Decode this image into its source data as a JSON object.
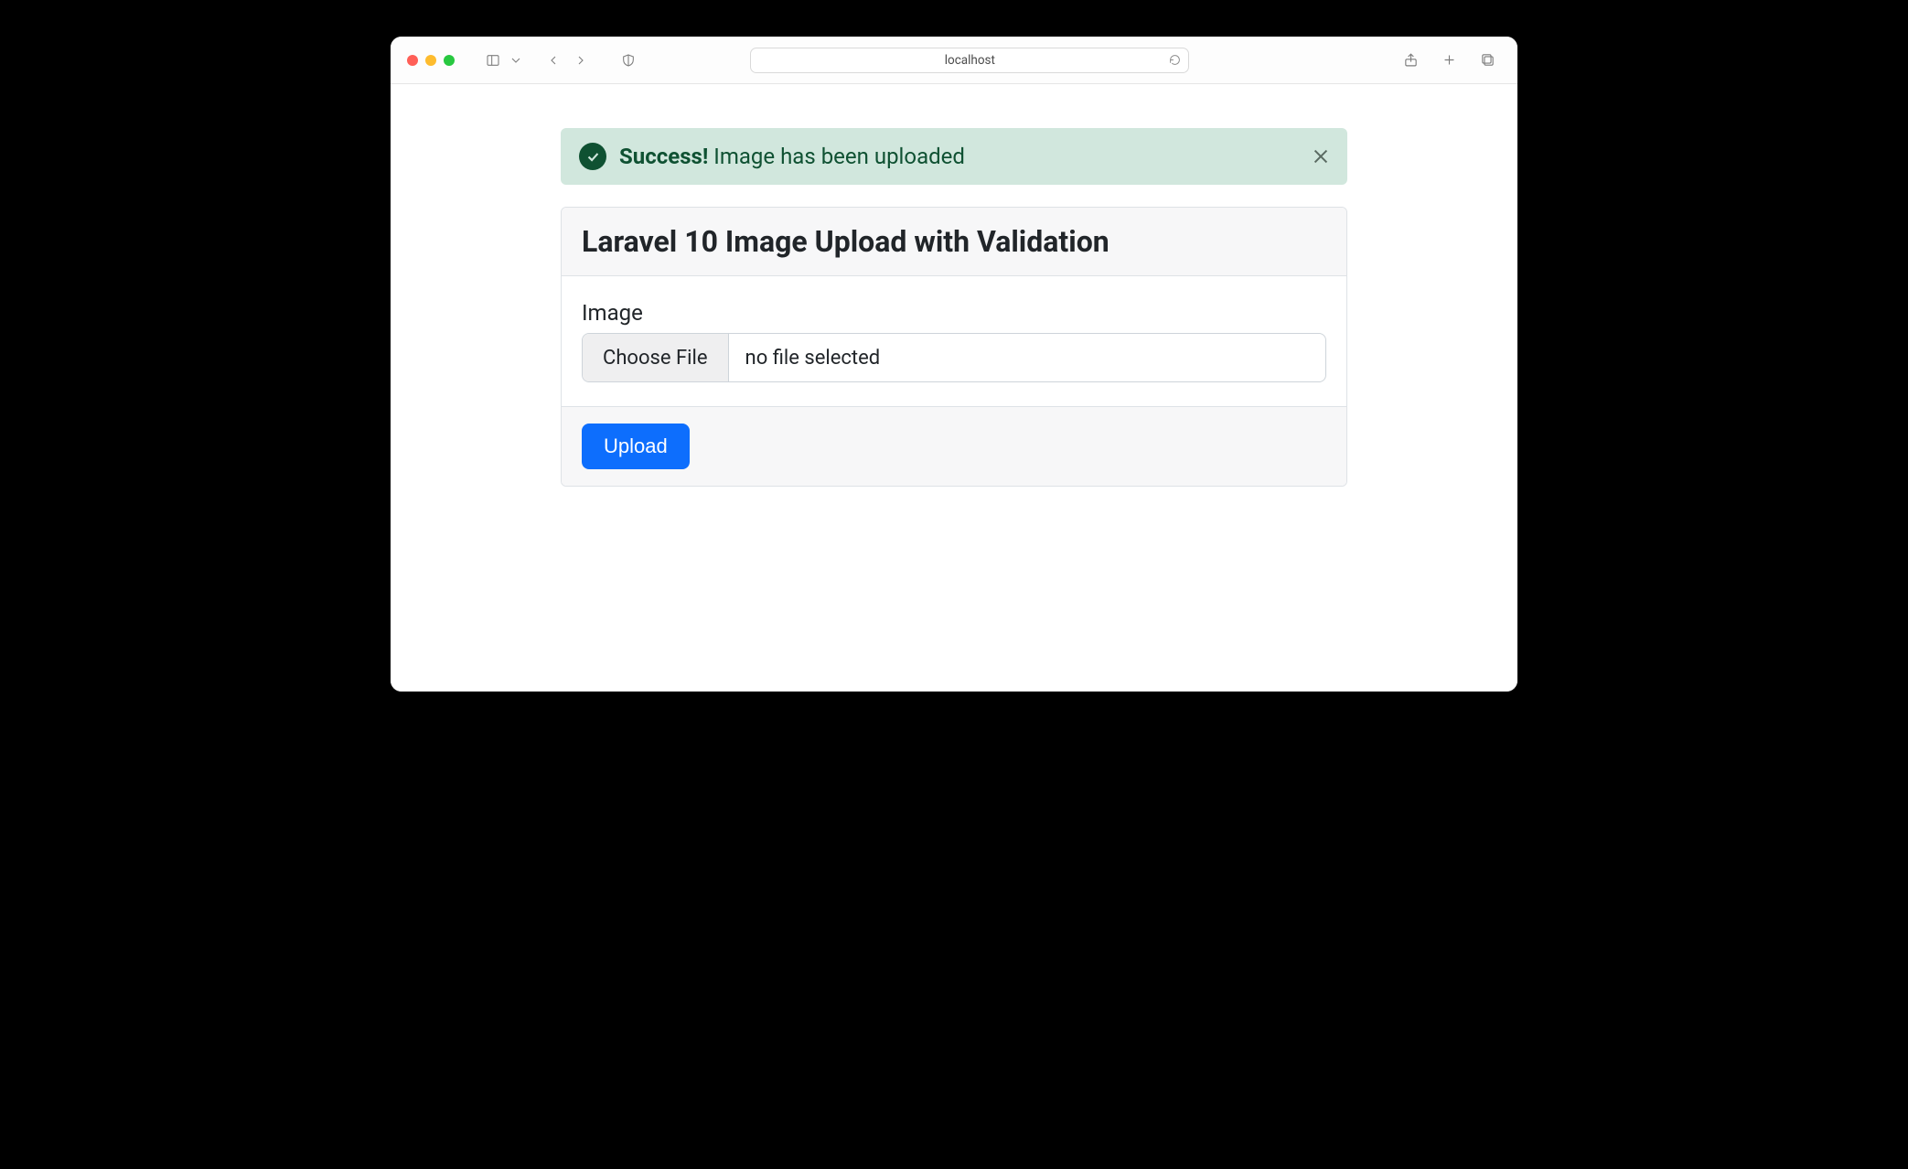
{
  "browser": {
    "url_display": "localhost"
  },
  "alert": {
    "strong": "Success!",
    "message": " Image has been uploaded"
  },
  "card": {
    "title": "Laravel 10 Image Upload with Validation",
    "image_label": "Image",
    "choose_file_label": "Choose File",
    "no_file_text": "no file selected",
    "upload_label": "Upload"
  }
}
